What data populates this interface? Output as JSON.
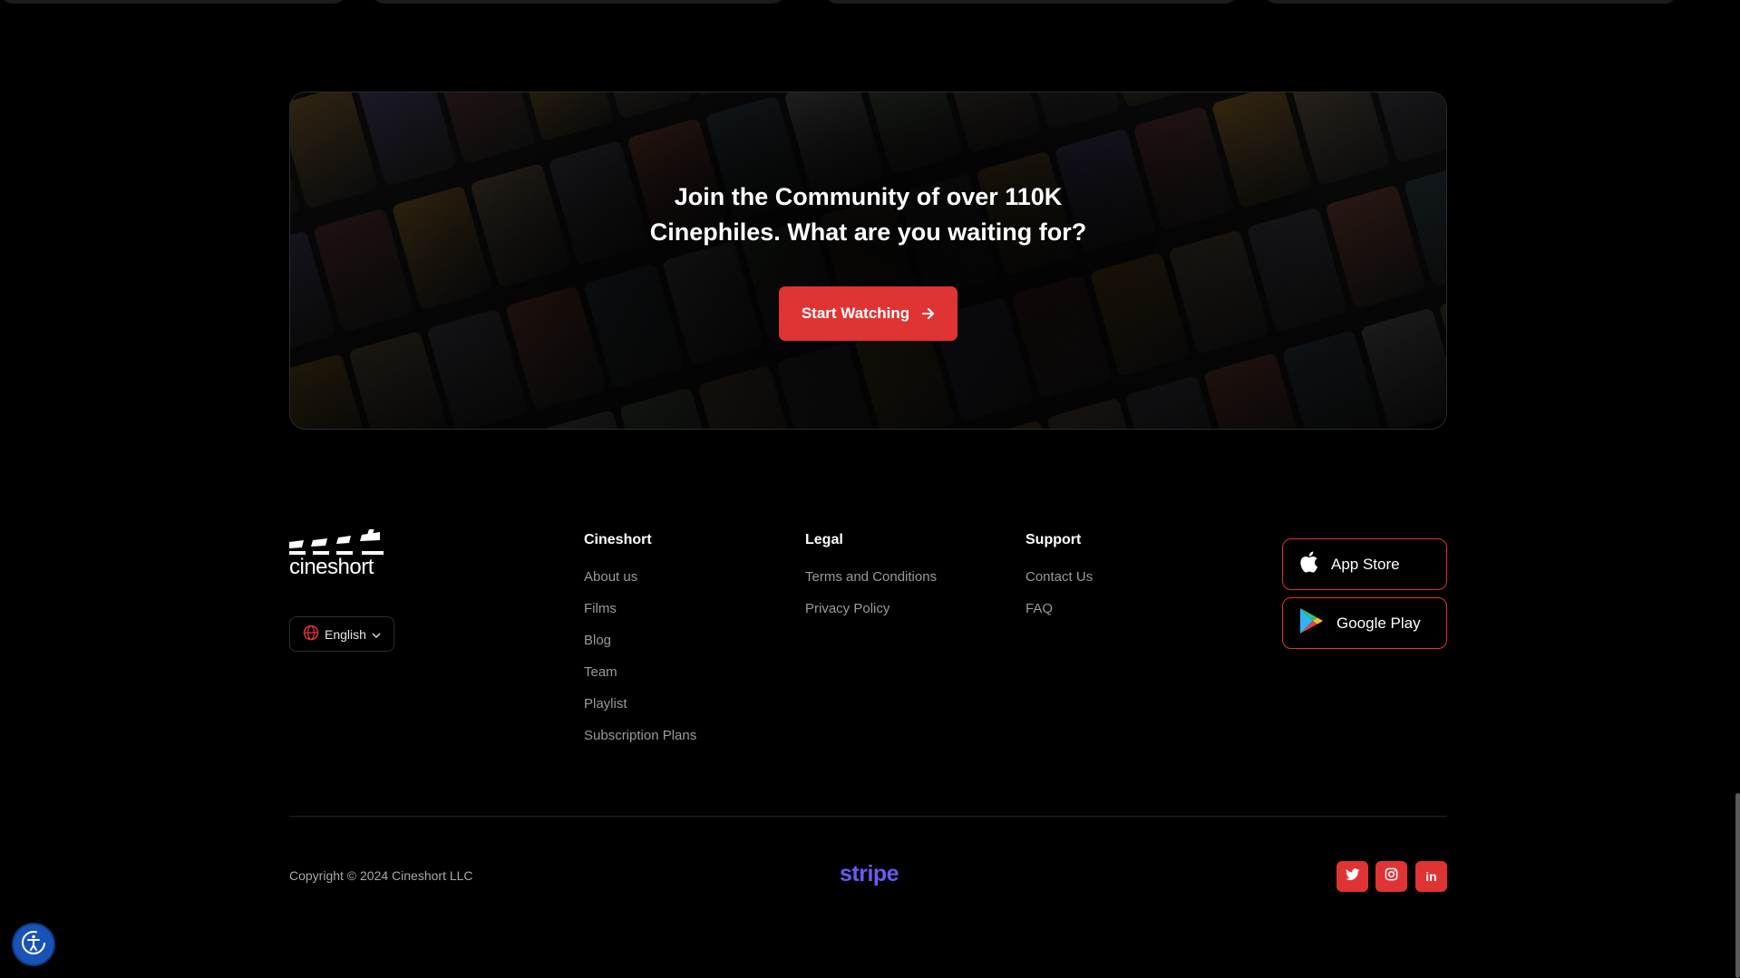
{
  "cta": {
    "title": "Join the Community of over 110K\nCinephiles. What are you waiting for?",
    "button_label": "Start Watching",
    "button_icon": "arrow-right-icon"
  },
  "brand": {
    "logo_text": "cineshort",
    "accent_color": "#e03434"
  },
  "language": {
    "selected": "English",
    "icon": "globe-icon"
  },
  "footer": {
    "columns": [
      {
        "title": "Cineshort",
        "links": [
          "About us",
          "Films",
          "Blog",
          "Team",
          "Playlist",
          "Subscription Plans"
        ]
      },
      {
        "title": "Legal",
        "links": [
          "Terms and Conditions",
          "Privacy Policy"
        ]
      },
      {
        "title": "Support",
        "links": [
          "Contact Us",
          "FAQ"
        ]
      }
    ],
    "stores": [
      {
        "label": "App Store",
        "icon": "apple-icon"
      },
      {
        "label": "Google Play",
        "icon": "google-play-icon"
      }
    ],
    "copyright": "Copyright © 2024 Cineshort LLC",
    "payment_logo": "stripe",
    "social": [
      {
        "name": "twitter",
        "icon": "twitter-icon"
      },
      {
        "name": "instagram",
        "icon": "instagram-icon"
      },
      {
        "name": "linkedin",
        "icon": "linkedin-icon",
        "text": "in"
      }
    ]
  },
  "accessibility": {
    "icon": "accessibility-icon"
  }
}
